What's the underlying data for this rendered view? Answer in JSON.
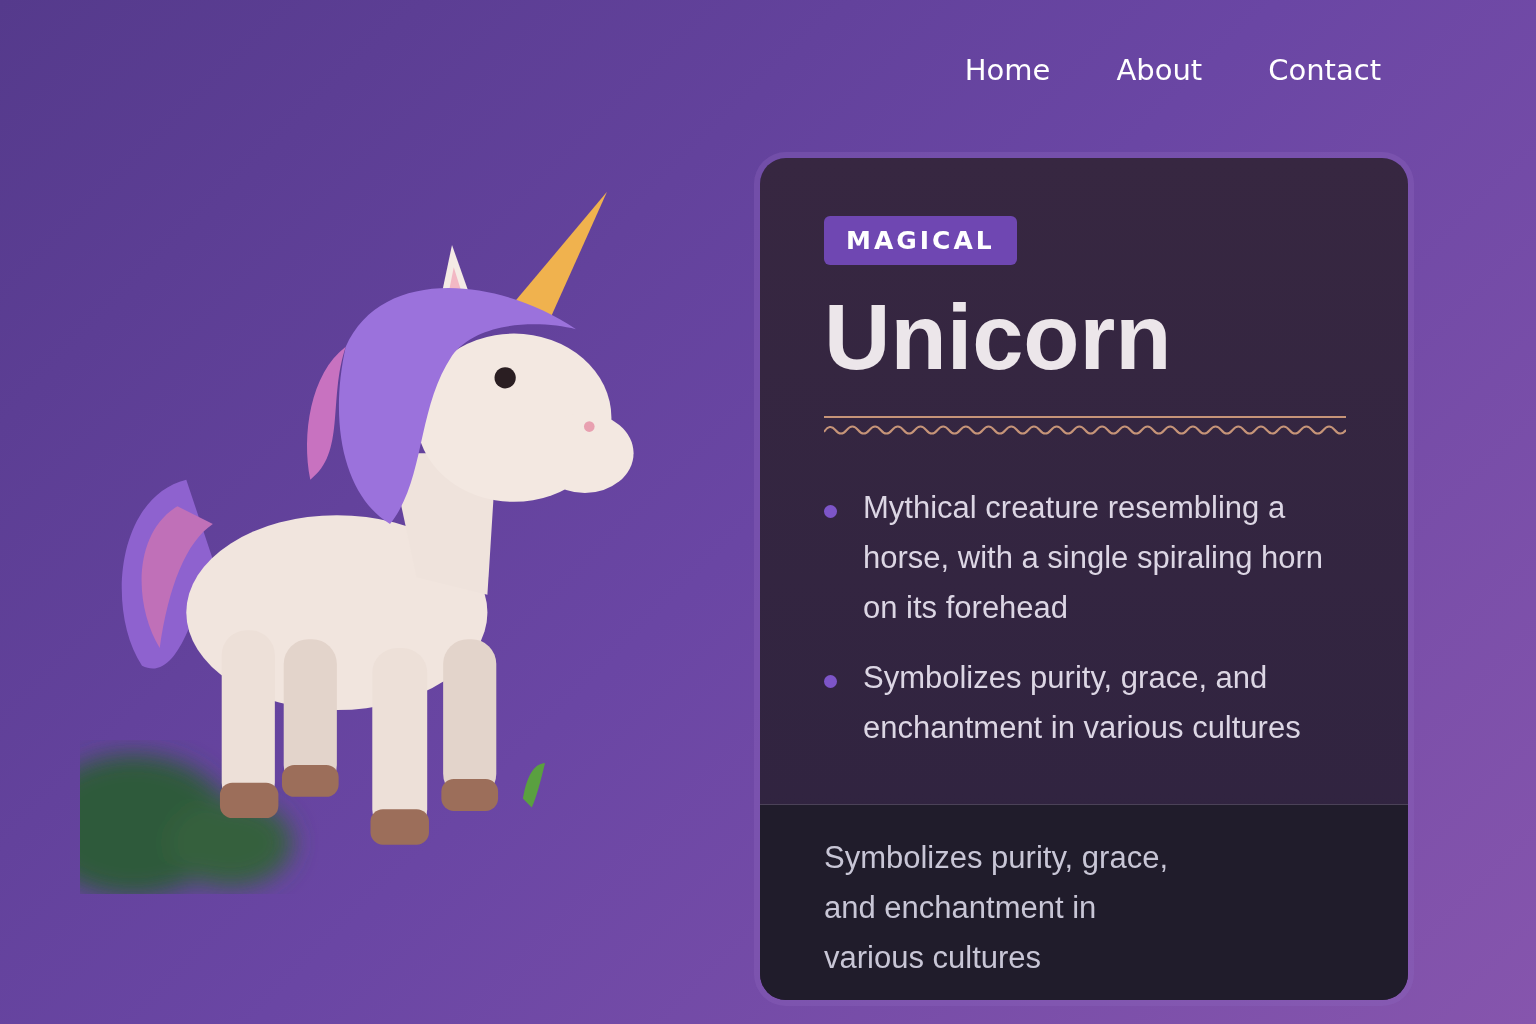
{
  "nav": [
    {
      "label": "Home"
    },
    {
      "label": "About"
    },
    {
      "label": "Contact"
    }
  ],
  "card": {
    "tag": "MAGICAL",
    "title": "Unicorn",
    "bullets": [
      "Mythical creature resembling a horse, with a single spiraling horn on its forehead",
      "Symbolizes purity, grace, and enchantment in various cultures"
    ],
    "footer": "Symbolizes purity, grace, and enchantment in various cultures"
  }
}
